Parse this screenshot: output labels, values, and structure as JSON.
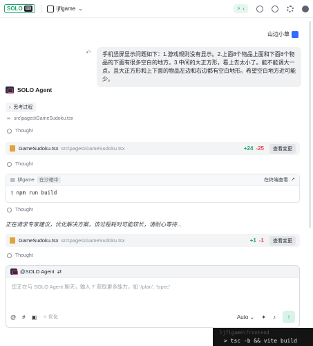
{
  "topbar": {
    "logo_text": "SOLO",
    "logo_badge": "⌨",
    "project_name": "ljflgame",
    "project_chevron": "⌄",
    "bolt_icon": "⚡",
    "bolt_chevron": "‹",
    "icons": [
      "chat-icon",
      "clock-icon",
      "settings-icon",
      "user-icon"
    ]
  },
  "user": {
    "name": "山边小草",
    "message": "手机竖屏显示问题如下：1.游戏规则没有显示。2.上面8个物品上面和下面8个物品的下面有很多空白的地方。3.中间的大正方形，看上去太小了。能不能调大一点。且大正方形和上下面的物品左边和右边都有空白地形。希望空白地方近可能少。"
  },
  "agent": {
    "name": "SOLO Agent",
    "thinking_label": "思考过程",
    "path_label": "src\\pages\\GameSudoku.tsx",
    "thought_label": "Thought"
  },
  "file_cards": [
    {
      "name": "GameSudoku.tsx",
      "path": "src\\pages\\GameSudoku.tsx",
      "added": "+24",
      "removed": "-25",
      "button": "查看变更"
    },
    {
      "name": "GameSudoku.tsx",
      "path": "src\\pages\\GameSudoku.tsx",
      "added": "+1",
      "removed": "-1",
      "button": "查看变更"
    }
  ],
  "terminal": {
    "name": "ljflgame",
    "status": "在沙箱中",
    "open_label": "在终端查看",
    "prompt": "$",
    "command": "npm run build"
  },
  "status_message": "正在请求专家建议，优化解决方案，该过程耗时可能较长，请耐心等待...",
  "composer": {
    "mention": "@SOLO Agent",
    "placeholder": "您正在与 SOLO Agent 聊天，输入 '/' 获取更多能力，如 '/plan', '/spec'",
    "optimize_label": "优化",
    "model_label": "Auto",
    "at_symbol": "@",
    "hash_symbol": "#"
  },
  "background_terminal": {
    "line1": "ljflgame\\frontend",
    "line2": "> tsc -b && vite build"
  }
}
